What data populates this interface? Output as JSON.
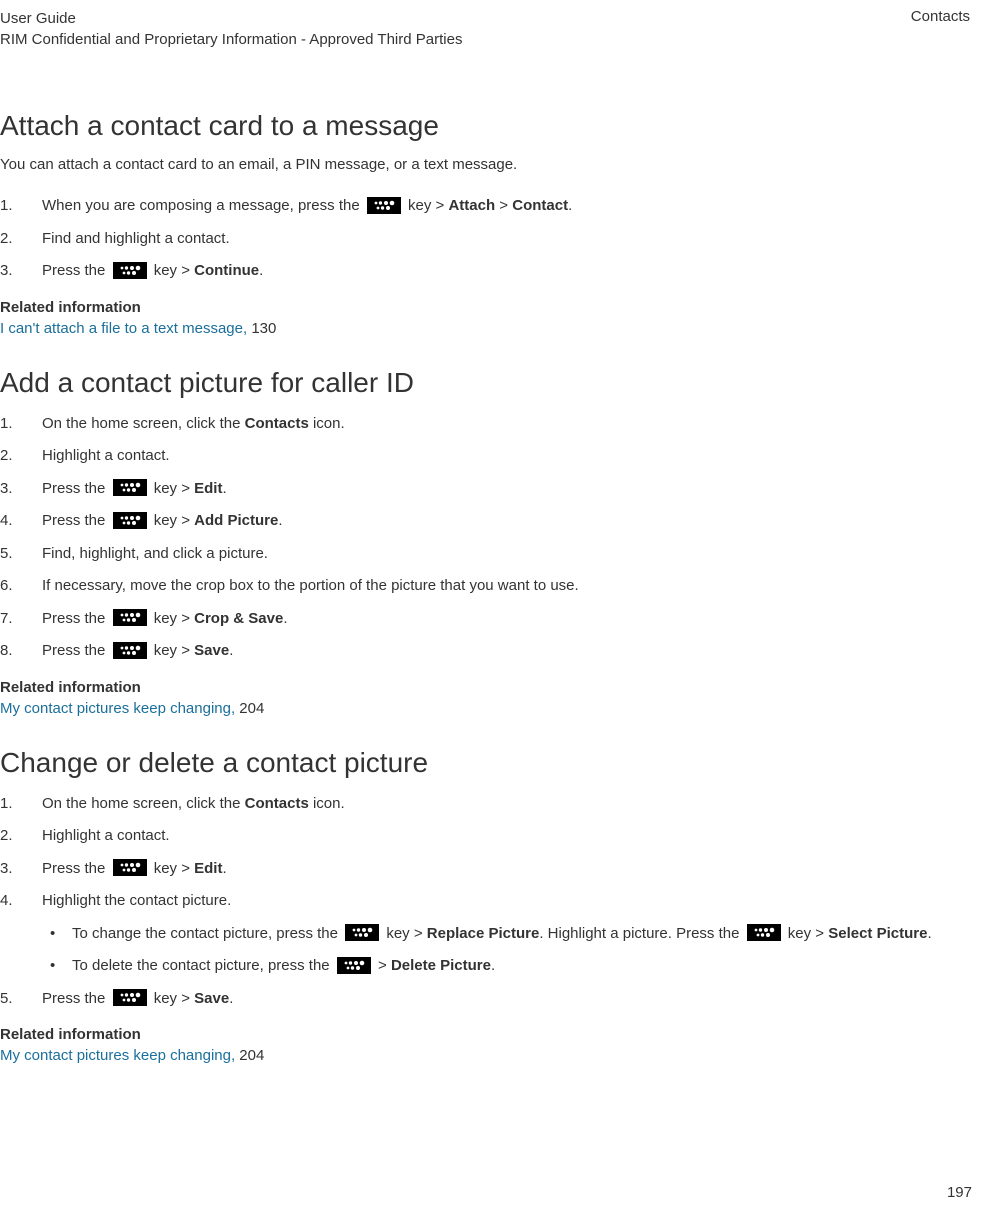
{
  "header": {
    "title1": "User Guide",
    "title2": "RIM Confidential and Proprietary Information - Approved Third Parties",
    "section": "Contacts"
  },
  "s1": {
    "heading": "Attach a contact card to a message",
    "intro": "You can attach a contact card to an email, a PIN message, or a text message.",
    "step1_a": "When you are composing a message, press the ",
    "step1_b": " key > ",
    "step1_attach": "Attach",
    "step1_gt": " > ",
    "step1_contact": "Contact",
    "step1_period": ".",
    "step2": "Find and highlight a contact.",
    "step3_a": "Press the ",
    "step3_b": " key > ",
    "step3_continue": "Continue",
    "step3_period": ".",
    "rel_title": "Related information",
    "rel_link": "I can't attach a file to a text message, ",
    "rel_page": "130"
  },
  "s2": {
    "heading": "Add a contact picture for caller ID",
    "step1_a": "On the home screen, click the ",
    "step1_contacts": "Contacts",
    "step1_b": " icon.",
    "step2": "Highlight a contact.",
    "step3_a": "Press the ",
    "step3_b": " key > ",
    "step3_edit": "Edit",
    "step3_period": ".",
    "step4_a": "Press the ",
    "step4_b": " key > ",
    "step4_add": "Add Picture",
    "step4_period": ".",
    "step5": "Find, highlight, and click a picture.",
    "step6": "If necessary, move the crop box to the portion of the picture that you want to use.",
    "step7_a": "Press the ",
    "step7_b": " key > ",
    "step7_crop": "Crop & Save",
    "step7_period": ".",
    "step8_a": "Press the ",
    "step8_b": " key > ",
    "step8_save": "Save",
    "step8_period": ".",
    "rel_title": "Related information",
    "rel_link": "My contact pictures keep changing, ",
    "rel_page": "204"
  },
  "s3": {
    "heading": "Change or delete a contact picture",
    "step1_a": "On the home screen, click the ",
    "step1_contacts": "Contacts",
    "step1_b": " icon.",
    "step2": "Highlight a contact.",
    "step3_a": "Press the ",
    "step3_b": " key > ",
    "step3_edit": "Edit",
    "step3_period": ".",
    "step4": "Highlight the contact picture.",
    "bul1_a": "To change the contact picture, press the ",
    "bul1_b": " key > ",
    "bul1_replace": "Replace Picture",
    "bul1_c": ". Highlight a picture. Press the ",
    "bul1_d": " key > ",
    "bul1_select": "Select Picture",
    "bul1_period": ".",
    "bul2_a": "To delete the contact picture, press the ",
    "bul2_b": " > ",
    "bul2_delete": "Delete Picture",
    "bul2_period": ".",
    "step5_a": "Press the ",
    "step5_b": " key > ",
    "step5_save": "Save",
    "step5_period": ".",
    "rel_title": "Related information",
    "rel_link": "My contact pictures keep changing, ",
    "rel_page": "204"
  },
  "page_number": "197"
}
